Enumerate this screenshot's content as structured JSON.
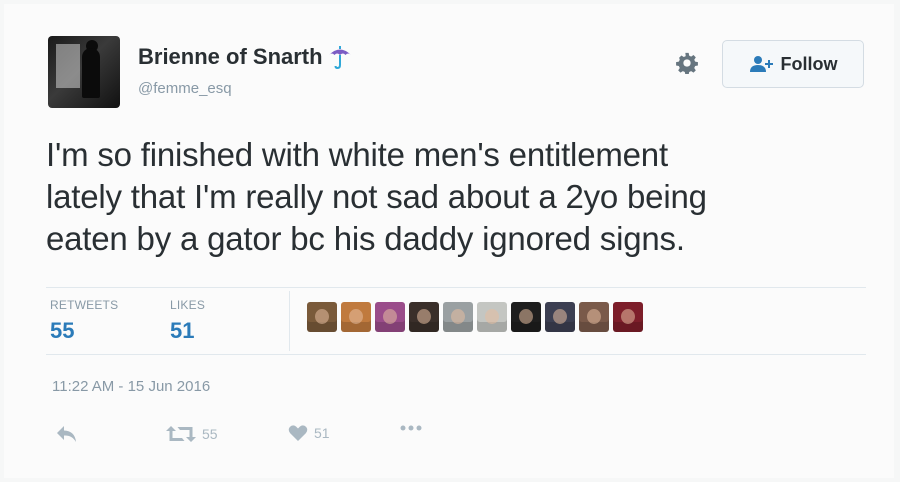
{
  "user": {
    "display_name": "Brienne of Snarth",
    "handle": "@femme_esq",
    "emoji_icon": "umbrella-icon"
  },
  "header_actions": {
    "settings_icon": "gear-icon",
    "follow_label": "Follow"
  },
  "tweet": {
    "lines": [
      "I'm so finished with white men's entitlement",
      "lately that I'm really not sad about a 2yo being",
      "eaten by a gator bc his daddy ignored signs."
    ],
    "timestamp": "11:22 AM - 15 Jun 2016"
  },
  "stats": {
    "retweets_label": "RETWEETS",
    "retweets_count": "55",
    "likes_label": "LIKES",
    "likes_count": "51"
  },
  "liker_avatars": [
    "#7a5a3a",
    "#c07a3e",
    "#9a4c8a",
    "#3a2f2a",
    "#9aa0a2",
    "#c4c6c2",
    "#1e1e1e",
    "#3c3f52",
    "#7a5a4a",
    "#7d1e2a"
  ],
  "actions": {
    "reply_icon": "reply-icon",
    "retweet_count": "55",
    "like_count": "51",
    "more_icon": "more-icon"
  },
  "colors": {
    "link_blue": "#2b7bb9",
    "muted": "#8899a6",
    "text": "#292f33"
  }
}
